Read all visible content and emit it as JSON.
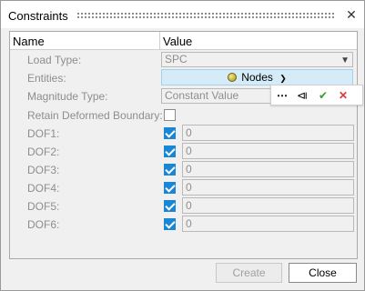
{
  "window": {
    "title": "Constraints"
  },
  "table": {
    "col_name": "Name",
    "col_value": "Value"
  },
  "rows": {
    "load_type": {
      "label": "Load Type:",
      "value": "SPC"
    },
    "entities": {
      "label": "Entities:",
      "value": "Nodes"
    },
    "magnitude_type": {
      "label": "Magnitude Type:",
      "value": "Constant Value"
    },
    "retain": {
      "label": "Retain Deformed Boundary:"
    }
  },
  "dofs": [
    {
      "label": "DOF1:",
      "value": "0"
    },
    {
      "label": "DOF2:",
      "value": "0"
    },
    {
      "label": "DOF3:",
      "value": "0"
    },
    {
      "label": "DOF4:",
      "value": "0"
    },
    {
      "label": "DOF5:",
      "value": "0"
    },
    {
      "label": "DOF6:",
      "value": "0"
    }
  ],
  "toolbar": {
    "more": "⋯",
    "reset": "⧏",
    "ok": "✔",
    "cancel": "✕"
  },
  "buttons": {
    "create": "Create",
    "close": "Close"
  },
  "colors": {
    "accent": "#1a86d6",
    "entity_bg": "#d5ecf8",
    "ok_green": "#2e9e2e",
    "cancel_red": "#d23a3a"
  }
}
